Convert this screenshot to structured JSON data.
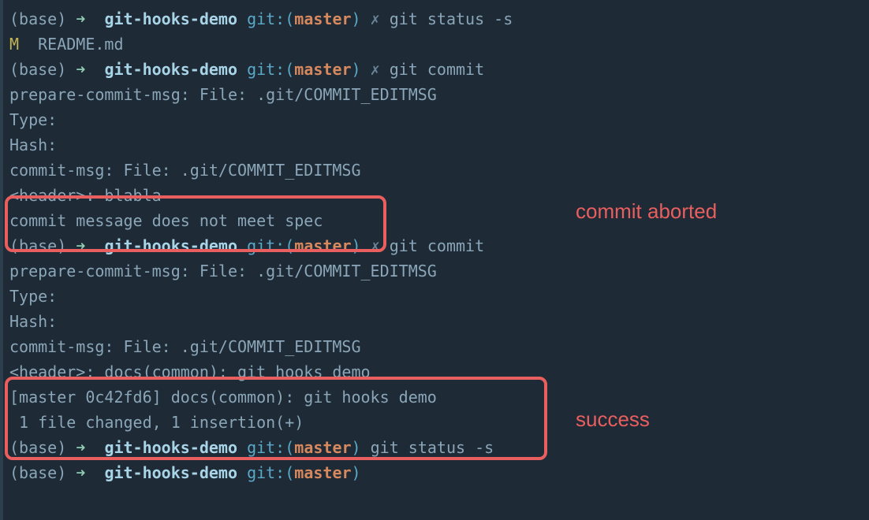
{
  "prompts": {
    "base": "(base)",
    "arrow": "➜",
    "dir": "git-hooks-demo",
    "gitPrefix": "git:(",
    "branch": "master",
    "gitSuffix": ")",
    "dirty": "✗"
  },
  "commands": {
    "status": "git status -s",
    "commit": "git commit"
  },
  "output": {
    "statusLine": "M  README.md",
    "prepare": "prepare-commit-msg: File: .git/COMMIT_EDITMSG",
    "type": "Type:",
    "hash": "Hash:",
    "commitMsg": "commit-msg: File: .git/COMMIT_EDITMSG",
    "badHeader": "<header>: blabla",
    "badMessage": "commit message does not meet spec",
    "goodHeader": "<header>: docs(common): git hooks demo",
    "commitResult": "[master 0c42fd6] docs(common): git hooks demo",
    "fileChanged": " 1 file changed, 1 insertion(+)"
  },
  "annotations": {
    "aborted": "commit aborted",
    "success": "success"
  }
}
